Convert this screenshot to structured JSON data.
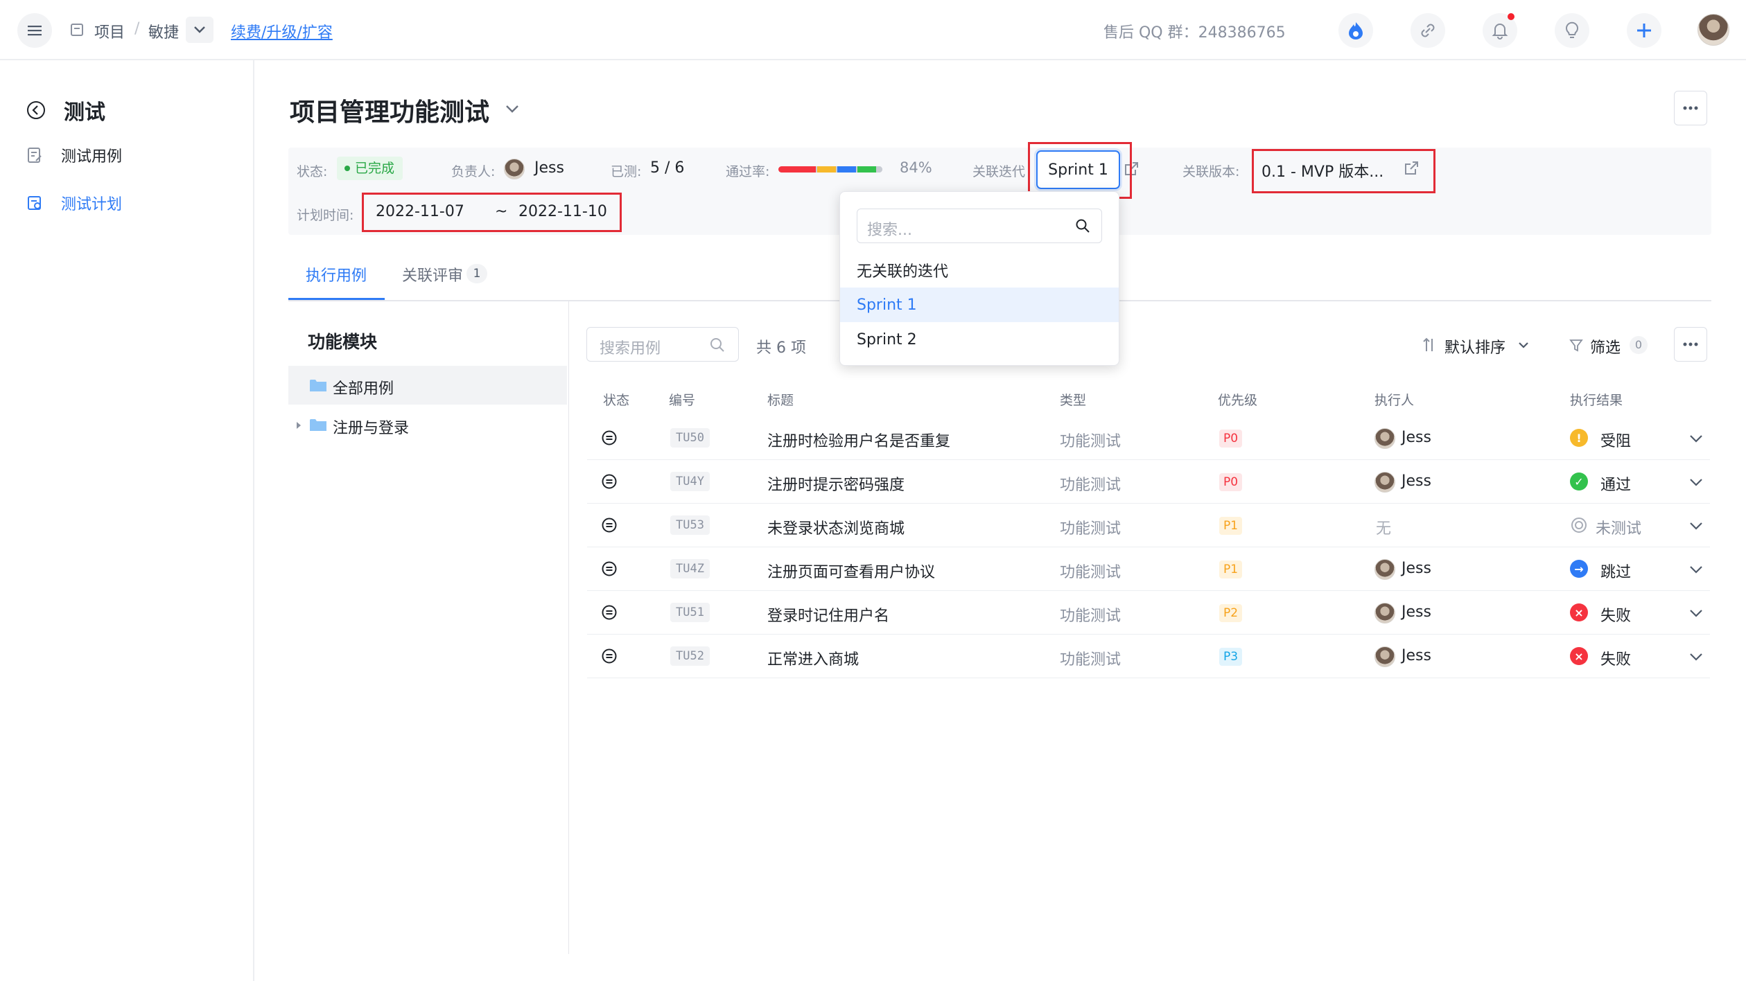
{
  "topbar": {
    "breadcrumb": {
      "root": "项目",
      "sep": "/",
      "project": "敏捷",
      "upgrade_link": "续费/升级/扩容"
    },
    "support_text": "售后 QQ 群：248386765",
    "icons": [
      "menu-icon",
      "project-icon",
      "chevron-down-icon",
      "flame-icon",
      "link-icon",
      "bell-icon",
      "lightbulb-icon",
      "plus-icon",
      "avatar"
    ],
    "notification_dot_color": "#f5222d"
  },
  "sidebar": {
    "back_title": "测试",
    "items": [
      {
        "label": "测试用例",
        "icon": "test-case-icon",
        "active": false
      },
      {
        "label": "测试计划",
        "icon": "test-plan-icon",
        "active": true
      }
    ]
  },
  "plan": {
    "title": "项目管理功能测试",
    "status_label": "状态:",
    "status_value": "已完成",
    "owner_label": "负责人:",
    "owner_name": "Jess",
    "tested_label": "已测:",
    "tested_value": "5 / 6",
    "pass_label": "通过率:",
    "pass_value": "84%",
    "pass_segments": [
      {
        "color": "#f5333f",
        "fraction": 0.36
      },
      {
        "color": "#f7b92b",
        "fraction": 0.18
      },
      {
        "color": "#2f7bf5",
        "fraction": 0.18
      },
      {
        "color": "#33c24d",
        "fraction": 0.18
      },
      {
        "color": "#c9cdd4",
        "fraction": 0.1
      }
    ],
    "sprint_label": "关联迭代",
    "sprint_value": "Sprint 1",
    "version_label": "关联版本:",
    "version_value": "0.1 - MVP 版本...",
    "time_label": "计划时间:",
    "start_date": "2022-11-07",
    "date_sep": "~",
    "end_date": "2022-11-10"
  },
  "dropdown": {
    "search_placeholder": "搜索...",
    "options": [
      {
        "label": "无关联的迭代",
        "selected": false
      },
      {
        "label": "Sprint 1",
        "selected": true
      },
      {
        "label": "Sprint 2",
        "selected": false
      }
    ]
  },
  "tabs": [
    {
      "label": "执行用例",
      "active": true
    },
    {
      "label": "关联评审",
      "badge": "1",
      "active": false
    }
  ],
  "modules": {
    "title": "功能模块",
    "items": [
      {
        "label": "全部用例",
        "selected": true
      },
      {
        "label": "注册与登录",
        "selected": false
      }
    ]
  },
  "toolbar": {
    "search_placeholder": "搜索用例",
    "count_text": "共 6 项",
    "sort_label": "默认排序",
    "filter_label": "筛选",
    "filter_count": "0"
  },
  "table": {
    "headers": [
      "状态",
      "编号",
      "标题",
      "类型",
      "优先级",
      "执行人",
      "执行结果"
    ],
    "rows": [
      {
        "code": "TU50",
        "title": "注册时检验用户名是否重复",
        "type": "功能测试",
        "priority": "P0",
        "assignee": "Jess",
        "result": "受阻",
        "result_kind": "blocked"
      },
      {
        "code": "TU4Y",
        "title": "注册时提示密码强度",
        "type": "功能测试",
        "priority": "P0",
        "assignee": "Jess",
        "result": "通过",
        "result_kind": "pass"
      },
      {
        "code": "TU53",
        "title": "未登录状态浏览商城",
        "type": "功能测试",
        "priority": "P1",
        "assignee": "无",
        "result": "未测试",
        "result_kind": "untested"
      },
      {
        "code": "TU4Z",
        "title": "注册页面可查看用户协议",
        "type": "功能测试",
        "priority": "P1",
        "assignee": "Jess",
        "result": "跳过",
        "result_kind": "skip"
      },
      {
        "code": "TU51",
        "title": "登录时记住用户名",
        "type": "功能测试",
        "priority": "P2",
        "assignee": "Jess",
        "result": "失败",
        "result_kind": "fail"
      },
      {
        "code": "TU52",
        "title": "正常进入商城",
        "type": "功能测试",
        "priority": "P3",
        "assignee": "Jess",
        "result": "失败",
        "result_kind": "fail"
      }
    ]
  },
  "colors": {
    "accent": "#2f7bf5",
    "highlight_box": "#e22b36",
    "status_green": "#2aa847",
    "p0": "#f5333f",
    "p1": "#f7a21b",
    "p2": "#f7a21b",
    "p3": "#14a5e6"
  }
}
